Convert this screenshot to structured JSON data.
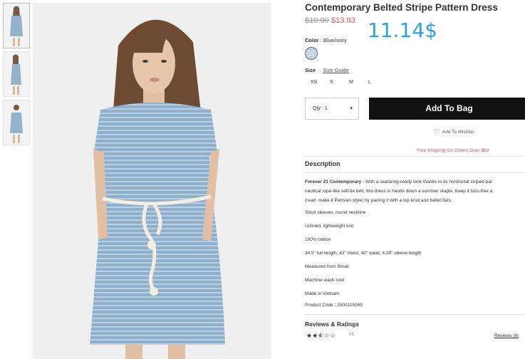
{
  "product": {
    "title": "Contemporary Belted Stripe Pattern Dress",
    "price_old": "$19.90",
    "price_new": "$13.93",
    "overlay_price": "11.14$"
  },
  "color": {
    "label": "Color",
    "value": "Blue/ivory"
  },
  "size": {
    "label": "Size",
    "guide_label": "Size Guide",
    "options": [
      "XS",
      "S",
      "M",
      "L"
    ]
  },
  "qty": {
    "label": "Qty : 1",
    "arrow": "▾"
  },
  "buttons": {
    "add_to_bag": "Add To Bag",
    "wishlist": "Add To Wishlist"
  },
  "shipping": "Free Shipping On Orders Over $50",
  "description": {
    "heading": "Description",
    "lead_bold": "Forever 21 Contemporary",
    "lead_text": " - With a seafaring-ready look thanks to its horizontal striped pat",
    "lead_line2": "nautical rope-like self-tie belt, this dress is hands down a summer staple. Keep it fuss-free a",
    "lead_line3": "(read: make it Parisian style) by pairing it with a top knot and ballet flats.",
    "items": [
      "Short sleeves, round neckline",
      "Unlined, lightweight knit",
      "100% cotton",
      "34.5\" full length, 42\" chest, 42\" waist, 4.25\" sleeve length",
      "Measured from Small",
      "Machine wash cold",
      "Made in Vietnam"
    ],
    "product_code": "Product Code : 2000115049"
  },
  "reviews": {
    "heading": "Reviews & Ratings",
    "rating": "2.5",
    "stars": "★★⯪☆☆",
    "link": "Reviews (6)"
  },
  "colors": {
    "dress": "#8fb0cc",
    "belt": "#f3ede2",
    "accent_price": "#2aa3df",
    "sale": "#e05a5a"
  }
}
